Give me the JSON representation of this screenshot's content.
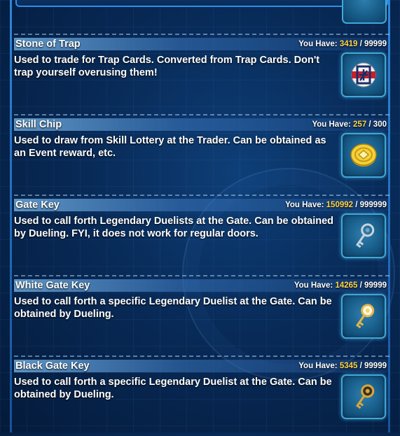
{
  "items": [
    {
      "name": "Stone of Trap",
      "have_label": "You Have:",
      "qty": "3419",
      "max": "/ 99999",
      "description": "Used to trade for Trap Cards. Converted from Trap Cards. Don't trap yourself overusing them!",
      "icon": "trap-stone-icon"
    },
    {
      "name": "Skill Chip",
      "have_label": "You Have:",
      "qty": "257",
      "max": "/ 300",
      "description": "Used to draw from Skill Lottery at the Trader. Can be obtained as an Event reward, etc.",
      "icon": "skill-chip-icon"
    },
    {
      "name": "Gate Key",
      "have_label": "You Have:",
      "qty": "150992",
      "max": "/ 999999",
      "description": "Used to call forth Legendary Duelists at the Gate. Can be obtained by Dueling. FYI, it does not work for regular doors.",
      "icon": "gate-key-icon"
    },
    {
      "name": "White Gate Key",
      "have_label": "You Have:",
      "qty": "14265",
      "max": "/ 99999",
      "description": "Used to call forth a specific Legendary Duelist at the Gate. Can be obtained by Dueling.",
      "icon": "white-gate-key-icon"
    },
    {
      "name": "Black Gate Key",
      "have_label": "You Have:",
      "qty": "5345",
      "max": "/ 99999",
      "description": "Used to call forth a specific Legendary Duelist at the Gate. Can be obtained by Dueling.",
      "icon": "black-gate-key-icon"
    }
  ],
  "colors": {
    "quantity": "#ffd54a",
    "frame": "#3fa8d8",
    "background": "#082a57"
  }
}
